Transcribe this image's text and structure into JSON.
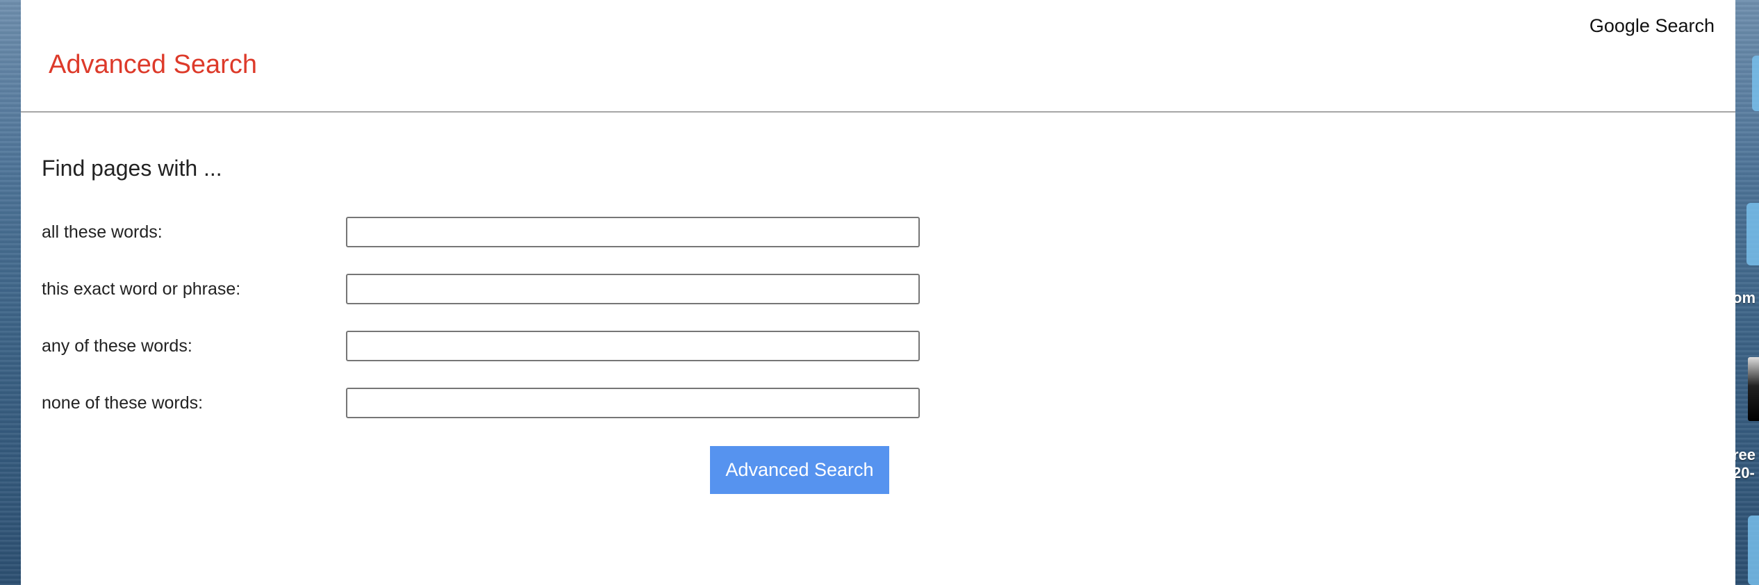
{
  "header": {
    "title": "Advanced Search",
    "top_link": "Google Search"
  },
  "form": {
    "section_title": "Find pages with ...",
    "rows": [
      {
        "label": "all these words:",
        "value": ""
      },
      {
        "label": "this exact word or phrase:",
        "value": ""
      },
      {
        "label": "any of these words:",
        "value": ""
      },
      {
        "label": "none of these words:",
        "value": ""
      }
    ],
    "submit_label": "Advanced Search"
  },
  "desktop": {
    "fragment_1": "om",
    "fragment_2": "ree",
    "fragment_3": "20-"
  },
  "colors": {
    "title_red": "#dd3a2a",
    "button_blue": "#5693ef"
  }
}
